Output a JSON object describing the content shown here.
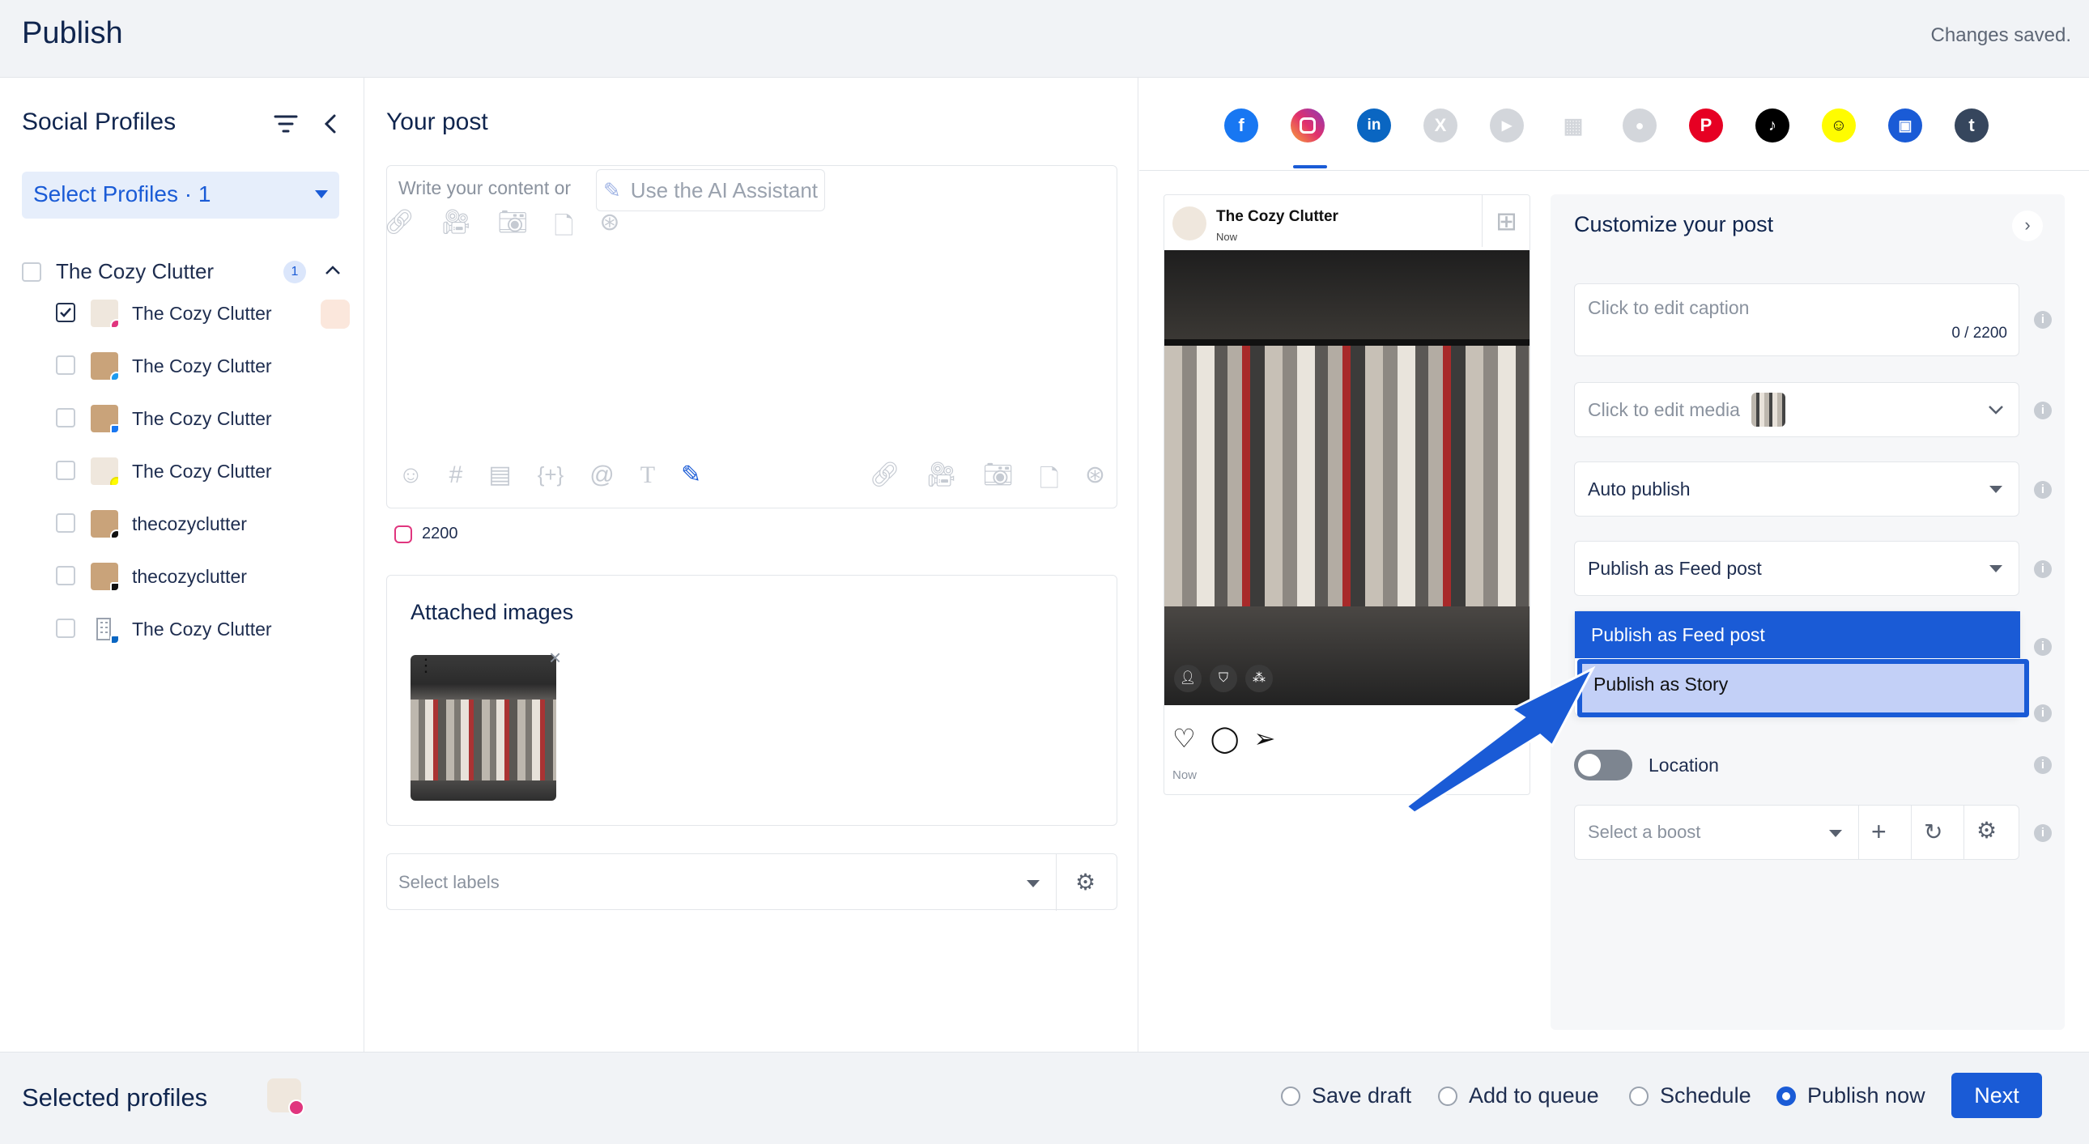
{
  "header": {
    "title": "Publish",
    "status": "Changes saved."
  },
  "left": {
    "title": "Social Profiles",
    "select_button": "Select Profiles · 1",
    "group": {
      "name": "The Cozy Clutter",
      "count": "1"
    },
    "profiles": [
      {
        "name": "The Cozy Clutter",
        "network": "instagram",
        "checked": true
      },
      {
        "name": "The Cozy Clutter",
        "network": "twitter",
        "checked": false
      },
      {
        "name": "The Cozy Clutter",
        "network": "facebook",
        "checked": false
      },
      {
        "name": "The Cozy Clutter",
        "network": "snapchat",
        "checked": false
      },
      {
        "name": "thecozyclutter",
        "network": "threads",
        "checked": false
      },
      {
        "name": "thecozyclutter",
        "network": "tiktok",
        "checked": false
      },
      {
        "name": "The Cozy Clutter",
        "network": "linkedin",
        "checked": false
      }
    ]
  },
  "post": {
    "title": "Your post",
    "placeholder": "Write your content or",
    "ai_label": "Use the AI Assistant",
    "char_count": "2200",
    "attached_title": "Attached images",
    "labels_placeholder": "Select labels"
  },
  "preview": {
    "account": "The Cozy Clutter",
    "time": "Now",
    "footer_time": "Now"
  },
  "customize": {
    "title": "Customize your post",
    "caption_placeholder": "Click to edit caption",
    "caption_count": "0 / 2200",
    "media_label": "Click to edit media",
    "auto_publish": "Auto publish",
    "publish_as": "Publish as Feed post",
    "dropdown_options": [
      "Publish as Feed post",
      "Publish as Story"
    ],
    "location_label": "Location",
    "boost_placeholder": "Select a boost"
  },
  "footer": {
    "selected_label": "Selected profiles",
    "options": [
      "Save draft",
      "Add to queue",
      "Schedule",
      "Publish now"
    ],
    "selected_option": "Publish now",
    "next_label": "Next"
  },
  "colors": {
    "accent": "#1a5bd6",
    "dropdown_highlight": "#1a5bd6",
    "story_option_bg": "#c3d0f7",
    "annotation_arrow": "#1a5bd6"
  }
}
